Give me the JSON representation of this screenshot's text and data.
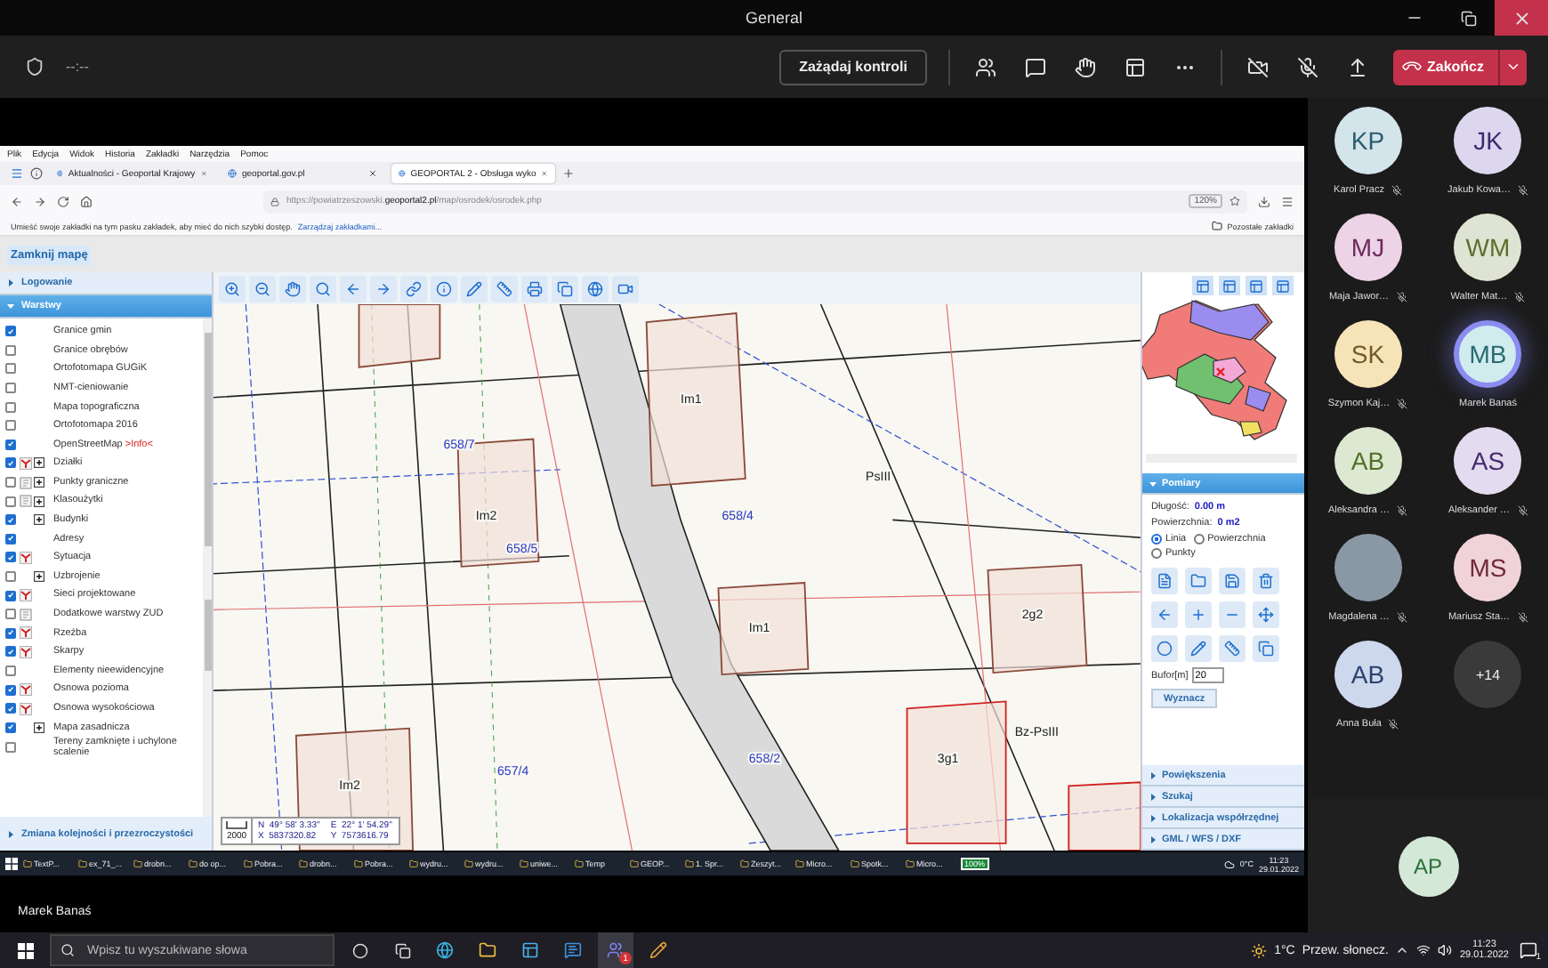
{
  "window": {
    "title": "General"
  },
  "meeting_toolbar": {
    "timer": "--:--",
    "request_control": "Zażądaj kontroli",
    "end_call": "Zakończ"
  },
  "shared_screen": {
    "browser": {
      "menu": [
        "Plik",
        "Edycja",
        "Widok",
        "Historia",
        "Zakładki",
        "Narzędzia",
        "Pomoc"
      ],
      "tabs": [
        {
          "label": "Aktualności - Geoportal Krajowy",
          "selected": false
        },
        {
          "label": "geoportal.gov.pl",
          "selected": false
        },
        {
          "label": "GEOPORTAL 2 - Obsługa wyko",
          "selected": true
        }
      ],
      "address_prefix": "https://powiatrzeszowski.",
      "address_domain": "geoportal2.pl",
      "address_path": "/map/osrodek/osrodek.php",
      "zoom": "120%",
      "bookmarks_hint": "Umieść swoje zakładki na tym pasku zakładek, aby mieć do nich szybki dostęp.",
      "bookmarks_link": "Zarządzaj zakładkami...",
      "other_bookmarks": "Pozostałe zakładki"
    },
    "close_map": "Zamknij mapę",
    "left_panel": {
      "sections": [
        {
          "label": "Logowanie",
          "expanded": false
        },
        {
          "label": "Warstwy",
          "expanded": true
        }
      ],
      "layers": [
        {
          "label": "Granice gmin",
          "checked": true,
          "kind": "plain",
          "expandable": false
        },
        {
          "label": "Granice obrębów",
          "checked": false,
          "kind": "plain",
          "expandable": false
        },
        {
          "label": "Ortofotomapa GUGiK",
          "checked": false,
          "kind": "plain",
          "expandable": false
        },
        {
          "label": "NMT-cieniowanie",
          "checked": false,
          "kind": "plain",
          "expandable": false
        },
        {
          "label": "Mapa topograficzna",
          "checked": false,
          "kind": "plain",
          "expandable": false
        },
        {
          "label": "Ortofotomapa 2016",
          "checked": false,
          "kind": "plain",
          "expandable": false
        },
        {
          "label": "OpenStreetMap",
          "note": ">Info<",
          "checked": true,
          "kind": "plain",
          "expandable": false
        },
        {
          "label": "Działki",
          "checked": true,
          "kind": "edit",
          "expandable": true
        },
        {
          "label": "Punkty graniczne",
          "checked": false,
          "kind": "doc",
          "expandable": true
        },
        {
          "label": "Klasoużytki",
          "checked": false,
          "kind": "doc",
          "expandable": true
        },
        {
          "label": "Budynki",
          "checked": true,
          "kind": "plain",
          "expandable": true
        },
        {
          "label": "Adresy",
          "checked": true,
          "kind": "plain",
          "expandable": false
        },
        {
          "label": "Sytuacja",
          "checked": true,
          "kind": "edit",
          "expandable": false
        },
        {
          "label": "Uzbrojenie",
          "checked": false,
          "kind": "plain",
          "expandable": true
        },
        {
          "label": "Sieci projektowane",
          "checked": true,
          "kind": "edit",
          "expandable": false
        },
        {
          "label": "Dodatkowe warstwy ZUD",
          "checked": false,
          "kind": "doc",
          "expandable": false
        },
        {
          "label": "Rzeźba",
          "checked": true,
          "kind": "edit",
          "expandable": false
        },
        {
          "label": "Skarpy",
          "checked": true,
          "kind": "edit",
          "expandable": false
        },
        {
          "label": "Elementy nieewidencyjne",
          "checked": false,
          "kind": "plain",
          "expandable": false
        },
        {
          "label": "Osnowa pozioma",
          "checked": true,
          "kind": "edit",
          "expandable": false
        },
        {
          "label": "Osnowa wysokościowa",
          "checked": true,
          "kind": "edit",
          "expandable": false
        },
        {
          "label": "Mapa zasadnicza",
          "checked": true,
          "kind": "plain",
          "expandable": true
        },
        {
          "label": "Tereny zamknięte i uchylone scalenie",
          "checked": false,
          "kind": "plain",
          "expandable": false
        }
      ],
      "bottom_section": "Zmiana kolejności i przezroczystości"
    },
    "map": {
      "labels": [
        "658/7",
        "658/4",
        "658/5",
        "658/2",
        "657/4",
        "Im2",
        "Im1",
        "Im1",
        "2g2",
        "3g1",
        "Im2",
        "PsIII",
        "Bz-PsIII"
      ],
      "coordinates": {
        "scale": "2000",
        "n": "N  49° 58' 3.33''",
        "e": "E  22° 1' 54.29''",
        "x": "X  5837320.82",
        "y": "Y  7573616.79"
      }
    },
    "right_panel": {
      "measurements": {
        "title": "Pomiary",
        "expanded": true,
        "length_label": "Długość:",
        "length": "0.00 m",
        "area_label": "Powierzchnia:",
        "area": "0 m2",
        "modes": [
          {
            "label": "Linia",
            "selected": true
          },
          {
            "label": "Powierzchnia",
            "selected": false
          },
          {
            "label": "Punkty",
            "selected": false
          }
        ],
        "buffer_label": "Bufor[m]",
        "buffer": "20",
        "compute": "Wyznacz"
      },
      "sections": [
        {
          "label": "Powiększenia",
          "expanded": false
        },
        {
          "label": "Szukaj",
          "expanded": false
        },
        {
          "label": "Lokalizacja współrzędnej",
          "expanded": false
        },
        {
          "label": "GML / WFS / DXF",
          "expanded": false
        }
      ]
    },
    "remote_taskbar": {
      "apps": [
        "TextP...",
        "ex_71_...",
        "drobn...",
        "do op...",
        "Pobra...",
        "drobn...",
        "Pobra...",
        "wydru...",
        "wydru...",
        "uniwe...",
        "Temp",
        "GEOP...",
        "1. Spr...",
        "Zeszyt...",
        "Micro...",
        "Spotk...",
        "Micro..."
      ],
      "battery": "100%",
      "weather": "0°C",
      "time": "11:23",
      "date": "29.01.2022"
    },
    "presenter": "Marek Banaś"
  },
  "participants": [
    {
      "initials": "KP",
      "name": "Karol Pracz",
      "muted": true,
      "speaking": false,
      "kind": "initials",
      "color": "#d3e4ea"
    },
    {
      "initials": "JK",
      "name": "Jakub Kowa…",
      "muted": true,
      "speaking": false,
      "kind": "initials",
      "color": "#dcd6ee"
    },
    {
      "initials": "MJ",
      "name": "Maja Jawor…",
      "muted": true,
      "speaking": false,
      "kind": "initials",
      "color": "#ecd3e6"
    },
    {
      "initials": "WM",
      "name": "Walter Mat…",
      "muted": true,
      "speaking": false,
      "kind": "initials",
      "color": "#dfe3d3"
    },
    {
      "initials": "SK",
      "name": "Szymon Kaj…",
      "muted": true,
      "speaking": false,
      "kind": "initials",
      "color": "#f6e4b8"
    },
    {
      "initials": "MB",
      "name": "Marek Banaś",
      "muted": false,
      "speaking": true,
      "kind": "initials",
      "color": "#d0ecee"
    },
    {
      "initials": "AB",
      "name": "Aleksandra …",
      "muted": true,
      "speaking": false,
      "kind": "initials",
      "color": "#dde8d0"
    },
    {
      "initials": "AS",
      "name": "Aleksander …",
      "muted": true,
      "speaking": false,
      "kind": "initials",
      "color": "#e3dbef"
    },
    {
      "name": "Magdalena …",
      "muted": true,
      "speaking": false,
      "kind": "photo"
    },
    {
      "initials": "MS",
      "name": "Mariusz Sta…",
      "muted": true,
      "speaking": false,
      "kind": "initials",
      "color": "#f0d3d8"
    },
    {
      "initials": "AB",
      "name": "Anna Buła",
      "muted": true,
      "speaking": false,
      "kind": "initials",
      "color": "#cdd8ec"
    },
    {
      "initials": "+14",
      "kind": "overflow"
    }
  ],
  "self": {
    "initials": "AP",
    "color": "#d4e8d8"
  },
  "local_taskbar": {
    "search_placeholder": "Wpisz tu wyszukiwane słowa",
    "teams_badge": "1",
    "weather": "1°C",
    "weather_text": "Przew. słonecz.",
    "time": "11:23",
    "date": "29.01.2022",
    "notifications": "1"
  }
}
